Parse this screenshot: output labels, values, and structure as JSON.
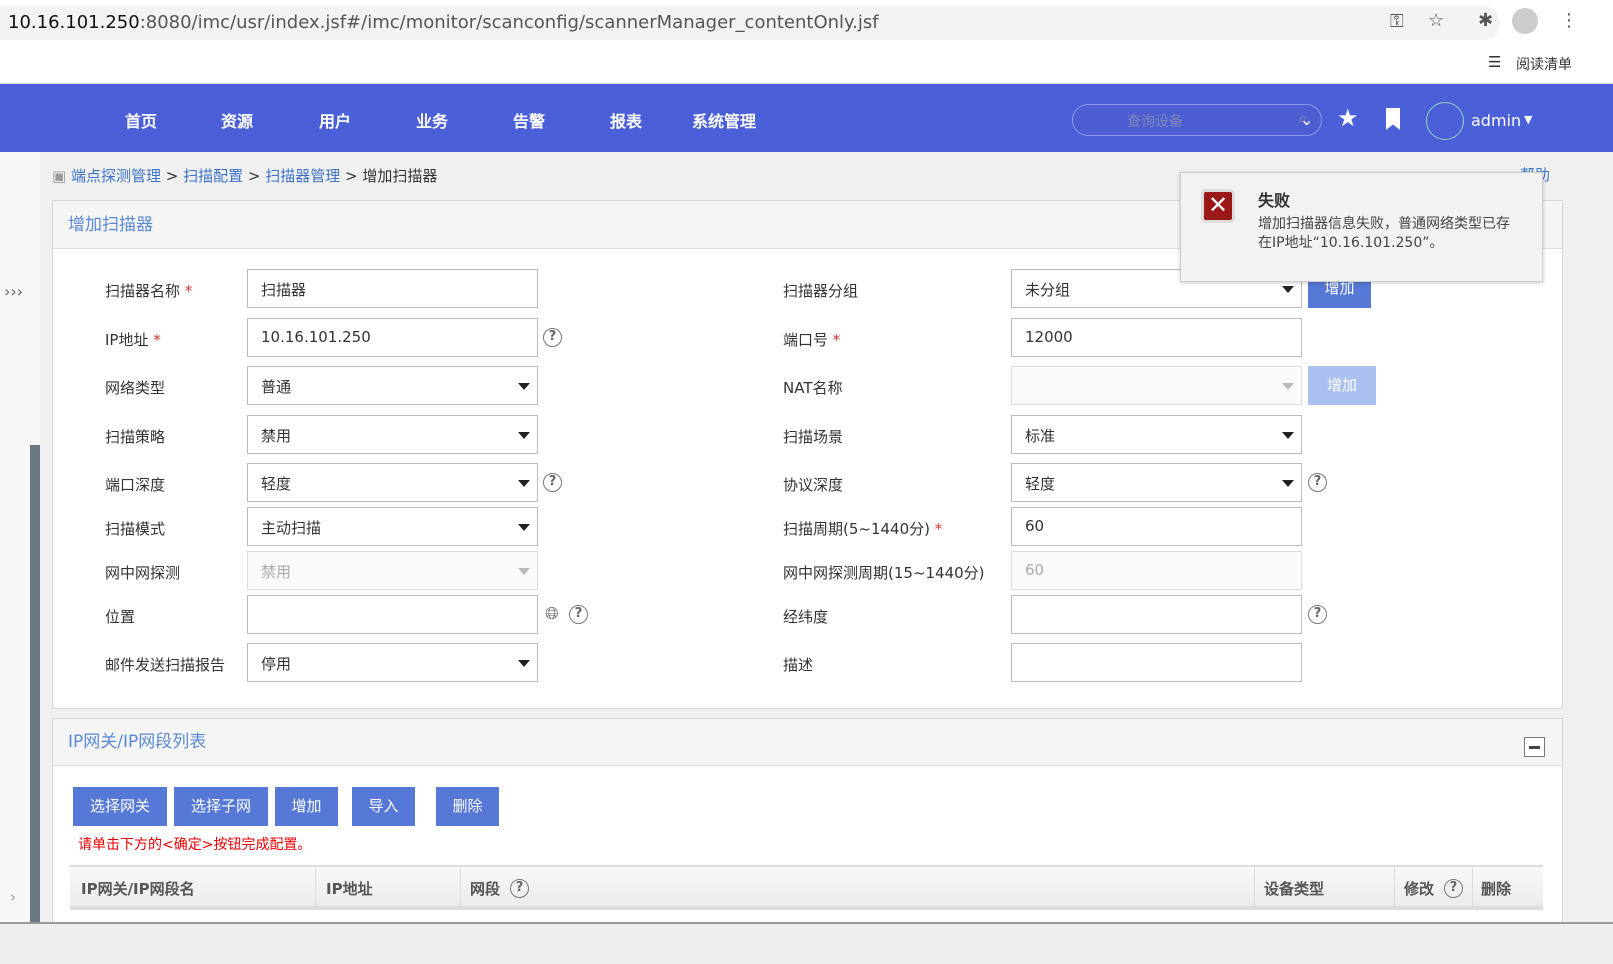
{
  "browser": {
    "url_host": "10.16.101.250",
    "url_rest": ":8080/imc/usr/index.jsf#/imc/monitor/scanconfig/scannerManager_contentOnly.jsf",
    "reading_list": "阅读清单"
  },
  "nav": {
    "items": [
      "首页",
      "资源",
      "用户",
      "业务",
      "告警",
      "报表",
      "系统管理"
    ],
    "search_placeholder": "查询设备",
    "user": "admin"
  },
  "breadcrumb": [
    "端点探测管理",
    "扫描配置",
    "扫描器管理",
    "增加扫描器"
  ],
  "help": "帮助",
  "form": {
    "title": "增加扫描器",
    "left": [
      {
        "label": "扫描器名称",
        "req": true,
        "value": "扫描器"
      },
      {
        "label": "IP地址",
        "req": true,
        "value": "10.16.101.250"
      },
      {
        "label": "网络类型",
        "value": "普通"
      },
      {
        "label": "扫描策略",
        "value": "禁用"
      },
      {
        "label": "端口深度",
        "value": "轻度"
      },
      {
        "label": "扫描模式",
        "value": "主动扫描"
      },
      {
        "label": "网中网探测",
        "value": "禁用"
      },
      {
        "label": "位置",
        "value": ""
      },
      {
        "label": "邮件发送扫描报告",
        "value": "停用"
      }
    ],
    "right": [
      {
        "label": "扫描器分组",
        "value": "未分组"
      },
      {
        "label": "端口号",
        "req": true,
        "value": "12000"
      },
      {
        "label": "NAT名称",
        "value": ""
      },
      {
        "label": "扫描场景",
        "value": "标准"
      },
      {
        "label": "协议深度",
        "value": "轻度"
      },
      {
        "label": "扫描周期(5~1440分)",
        "req": true,
        "value": "60"
      },
      {
        "label": "网中网探测周期(15~1440分)",
        "value": "60"
      },
      {
        "label": "经纬度",
        "value": ""
      },
      {
        "label": "描述",
        "value": ""
      }
    ],
    "add_label": "增加"
  },
  "ip_list": {
    "title": "IP网关/IP网段列表",
    "buttons": [
      "选择网关",
      "选择子网",
      "增加",
      "导入",
      "删除"
    ],
    "hint": "请单击下方的<确定>按钮完成配置。",
    "columns": [
      "IP网关/IP网段名",
      "IP地址",
      "网段",
      "设备类型",
      "修改",
      "删除"
    ]
  },
  "toast": {
    "title": "失败",
    "message": "增加扫描器信息失败，普通网络类型已存在IP地址“10.16.101.250”。"
  }
}
